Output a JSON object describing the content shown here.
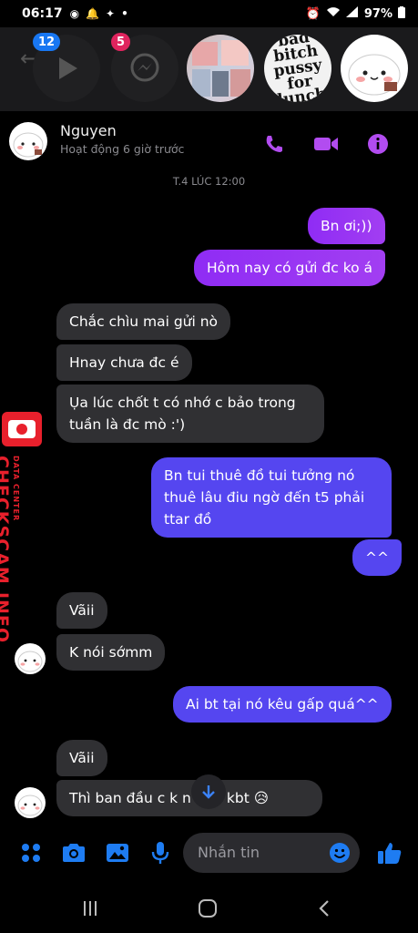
{
  "status_bar": {
    "time": "06:17",
    "battery": "97%"
  },
  "chat_heads": {
    "badge_1": "12",
    "badge_2": "5",
    "head_4_text": "bad bitch pussy for lunch"
  },
  "conversation": {
    "name": "Nguyen",
    "subtitle": "Hoạt động 6 giờ trước",
    "accent_color": "#b24cf0"
  },
  "timestamp": "T.4 LÚC 12:00",
  "messages": [
    {
      "side": "sent",
      "text": "Bn ơi;))"
    },
    {
      "side": "sent",
      "text": "Hôm nay có gửi đc ko á"
    },
    {
      "side": "received",
      "text": "Chắc chìu mai gửi nò"
    },
    {
      "side": "received",
      "text": "Hnay chưa đc é"
    },
    {
      "side": "received",
      "text": "Ụa lúc chốt t có nhớ c bảo trong tuần là đc mò :')"
    },
    {
      "side": "sent",
      "text": "Bn tui thuê đồ tui tưởng nó thuê lâu điu ngờ đến t5 phải ttar đồ"
    },
    {
      "side": "sent",
      "text": "^^"
    },
    {
      "side": "received",
      "text": "Vãii"
    },
    {
      "side": "received",
      "text": "K nói sớmm"
    },
    {
      "side": "sent",
      "text": "Ai bt tại nó kêu gấp quá^^"
    },
    {
      "side": "received",
      "text": "Vãii"
    },
    {
      "side": "received",
      "text": "Thì ban đầu c k n    nên kbt 😥"
    }
  ],
  "watermark": {
    "sub": "DATA CENTER",
    "main": "CHECKSCAM.INFO"
  },
  "composer": {
    "placeholder": "Nhắn tin"
  },
  "icons": [
    "menu-dots-icon",
    "camera-icon",
    "gallery-icon",
    "microphone-icon",
    "emoji-icon",
    "like-icon",
    "phone-icon",
    "video-icon",
    "info-icon",
    "arrow-down-icon"
  ]
}
